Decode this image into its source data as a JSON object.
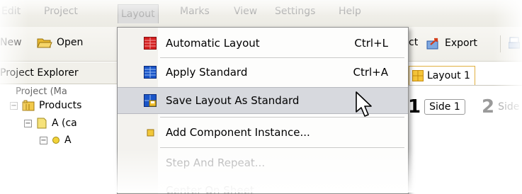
{
  "menubar": {
    "items": [
      "Edit",
      "Project",
      "Layout",
      "Marks",
      "View",
      "Settings",
      "Help"
    ]
  },
  "toolbar": {
    "new_label": "New",
    "open_label": "Open",
    "project_label": "ct",
    "export_label": "Export"
  },
  "explorer": {
    "header": "Project Explorer",
    "rows": [
      "Project (Ma",
      "Products",
      "A (ca",
      "A"
    ]
  },
  "tabs": {
    "layout_tab": "Layout 1",
    "side1_number": "1",
    "side1_label": "Side 1",
    "side2_number": "2",
    "side2_label": "Side"
  },
  "layout_menu": {
    "items": [
      {
        "label": "Automatic Layout",
        "shortcut": "Ctrl+L",
        "icon": "automatic-layout-icon"
      },
      {
        "label": "Apply Standard",
        "shortcut": "Ctrl+A",
        "icon": "apply-standard-icon"
      },
      {
        "label": "Save Layout As Standard",
        "shortcut": "",
        "icon": "save-layout-icon"
      },
      {
        "label": "Add Component Instance...",
        "shortcut": "",
        "icon": "component-instance-icon"
      },
      {
        "label": "Step And Repeat...",
        "shortcut": "",
        "icon": ""
      },
      {
        "label": "Center On Sheet",
        "shortcut": "",
        "icon": ""
      }
    ],
    "highlighted_index": 2
  },
  "colors": {
    "menu_highlight": "#d7d9de",
    "accent_red": "#d42020",
    "accent_blue": "#1a55c8",
    "folder_yellow": "#e8b830"
  }
}
